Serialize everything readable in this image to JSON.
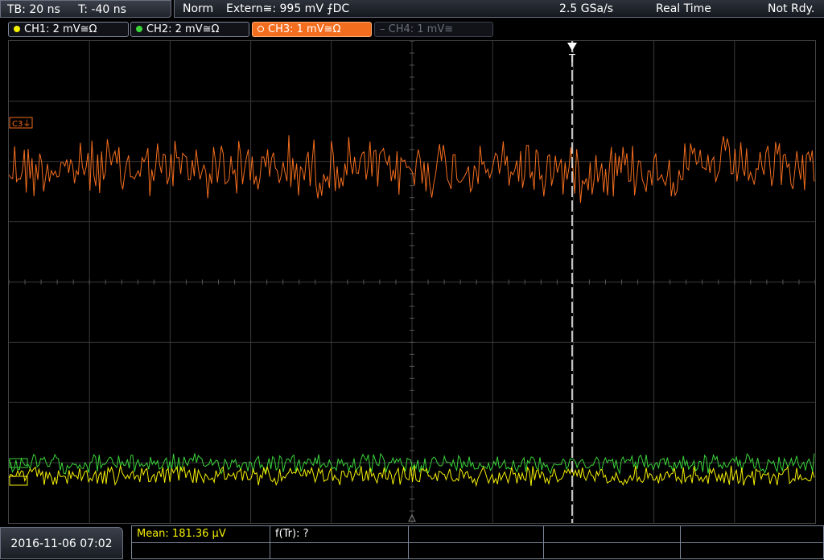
{
  "timebase": {
    "tb": "TB: 20 ns",
    "offset": "T: -40 ns"
  },
  "status": {
    "mode": "Norm",
    "trigger": "Extern≅: 995 mV ⨍DC",
    "sample_rate": "2.5 GSa/s",
    "acq_mode": "Real Time",
    "state": "Not Rdy."
  },
  "channels": [
    {
      "label": "CH1: 2 mV≅Ω",
      "color": "#f5f000",
      "active": false,
      "enabled": true
    },
    {
      "label": "CH2: 2 mV≅Ω",
      "color": "#3ad43a",
      "active": false,
      "enabled": true
    },
    {
      "label": "CH3: 1 mV≅Ω",
      "color": "#f36d1e",
      "active": true,
      "enabled": true
    },
    {
      "label": "CH4: 1 mV≅",
      "color": "#6a6e78",
      "active": false,
      "enabled": false
    }
  ],
  "markers": {
    "ch3": "C3",
    "trigger": "T"
  },
  "colors": {
    "ch1": "#f5f000",
    "ch2": "#3ad43a",
    "ch3": "#f36d1e",
    "grid": "#3a3a3a",
    "trigger": "#ffffff"
  },
  "footer": {
    "datetime": "2016-11-06 07:02",
    "mean": "Mean: 181.36 µV",
    "ftr": "f(Tr): ?"
  }
}
